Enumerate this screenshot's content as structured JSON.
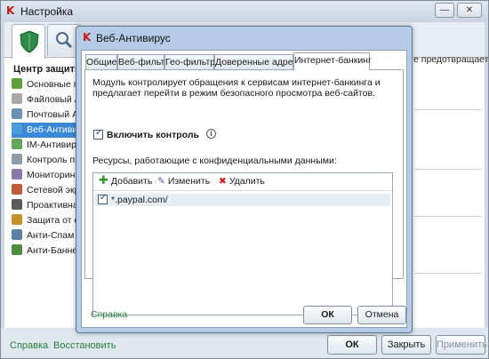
{
  "main_window": {
    "title": "Настройка",
    "sidebar_heading": "Центр защиты",
    "sidebar_items": [
      {
        "label": "Основные пар",
        "color": "#5f9e3a"
      },
      {
        "label": "Файловый Ан",
        "color": "#a8a8a8"
      },
      {
        "label": "Почтовый Ан",
        "color": "#6b8fb5"
      },
      {
        "label": "Веб-Антивиру",
        "color": "#4a9cdc"
      },
      {
        "label": "IM-Антивиру",
        "color": "#63a85a"
      },
      {
        "label": "Контроль про",
        "color": "#8b9cab"
      },
      {
        "label": "Мониторинг а",
        "color": "#8a7aa8"
      },
      {
        "label": "Сетевой экра",
        "color": "#c35b3a"
      },
      {
        "label": "Проактивная",
        "color": "#5b5b5b"
      },
      {
        "label": "Защита от сет",
        "color": "#c3932a"
      },
      {
        "label": "Анти-Спам",
        "color": "#5e7fa5"
      },
      {
        "label": "Анти-Баннер",
        "color": "#4d8d3f"
      }
    ],
    "background_text": "е предотвращает",
    "bottom": {
      "help_link": "Справка",
      "restore_link": "Восстановить",
      "ok": "ОК",
      "close": "Закрыть",
      "apply": "Применить"
    }
  },
  "dialog": {
    "title": "Веб-Антивирус",
    "tabs": [
      "Общие",
      "Веб-фильтр",
      "Гео-фильтр",
      "Доверенные адреса",
      "Интернет-банкинг"
    ],
    "active_tab": "Интернет-банкинг",
    "description": "Модуль контролирует обращения к сервисам интернет-банкинга и предлагает перейти в режим безопасного просмотра веб-сайтов.",
    "enable_checkbox": {
      "label": "Включить контроль",
      "checked": true
    },
    "resources_label": "Ресурсы, работающие с конфиденциальными данными:",
    "toolbar": {
      "add": "Добавить",
      "edit": "Изменить",
      "delete": "Удалить"
    },
    "resources": [
      {
        "url": "*.paypal.com/",
        "checked": true
      }
    ],
    "help_link": "Справка",
    "ok": "ОК",
    "cancel": "Отмена"
  }
}
